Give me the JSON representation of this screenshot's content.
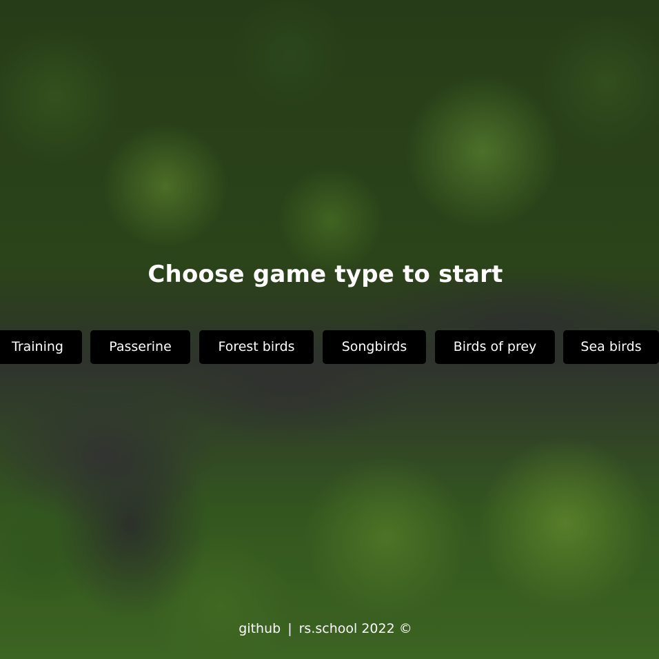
{
  "title": "Choose game type to start",
  "game_types": [
    {
      "label": "Training"
    },
    {
      "label": "Passerine"
    },
    {
      "label": "Forest birds"
    },
    {
      "label": "Songbirds"
    },
    {
      "label": "Birds of prey"
    },
    {
      "label": "Sea birds"
    }
  ],
  "footer": {
    "github_label": "github",
    "separator": "|",
    "school_label": "rs.school 2022 ©"
  },
  "colors": {
    "button_background": "#000000",
    "text": "#ffffff"
  },
  "background": "aerial-forest-river-photo"
}
